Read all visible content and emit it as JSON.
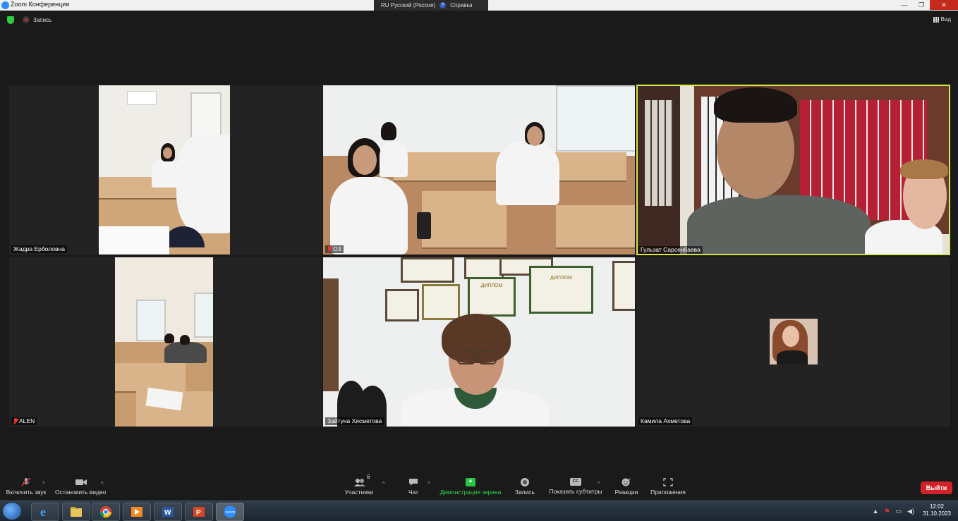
{
  "window": {
    "title": "Zoom Конференция",
    "language": "RU Русский (Россия)",
    "help": "Справка"
  },
  "topbar": {
    "recording_label": "Запись",
    "view_label": "Вид"
  },
  "participants": [
    {
      "name": "Жадра Ерболовна",
      "muted": false,
      "active": false
    },
    {
      "name": "ОЗ",
      "muted": true,
      "active": false
    },
    {
      "name": "Гульзат Сарсенбаева",
      "muted": false,
      "active": true
    },
    {
      "name": "ALEN",
      "muted": true,
      "active": false
    },
    {
      "name": "Зайтуна Хисметова",
      "muted": false,
      "active": false
    },
    {
      "name": "Камила Ахметова",
      "muted": false,
      "active": false
    }
  ],
  "toolbar": {
    "unmute": "Включить звук",
    "stop_video": "Остановить видео",
    "participants": "Участники",
    "participants_count": "6",
    "chat": "Чат",
    "share_screen": "Демонстрация экрана",
    "record": "Запись",
    "captions": "Показать субтитры",
    "captions_icon_text": "CC",
    "reactions": "Реакции",
    "apps": "Приложения",
    "leave": "Выйти"
  },
  "taskbar": {
    "time": "12:02",
    "date": "31.10.2023",
    "word_label": "W",
    "ppt_label": "P",
    "zoom_label": "zoom"
  },
  "frame_text": {
    "diploma": "ДИПЛОМ"
  },
  "colors": {
    "active_speaker": "#d4e84a",
    "share_green": "#23c840",
    "leave_red": "#d1222a"
  }
}
